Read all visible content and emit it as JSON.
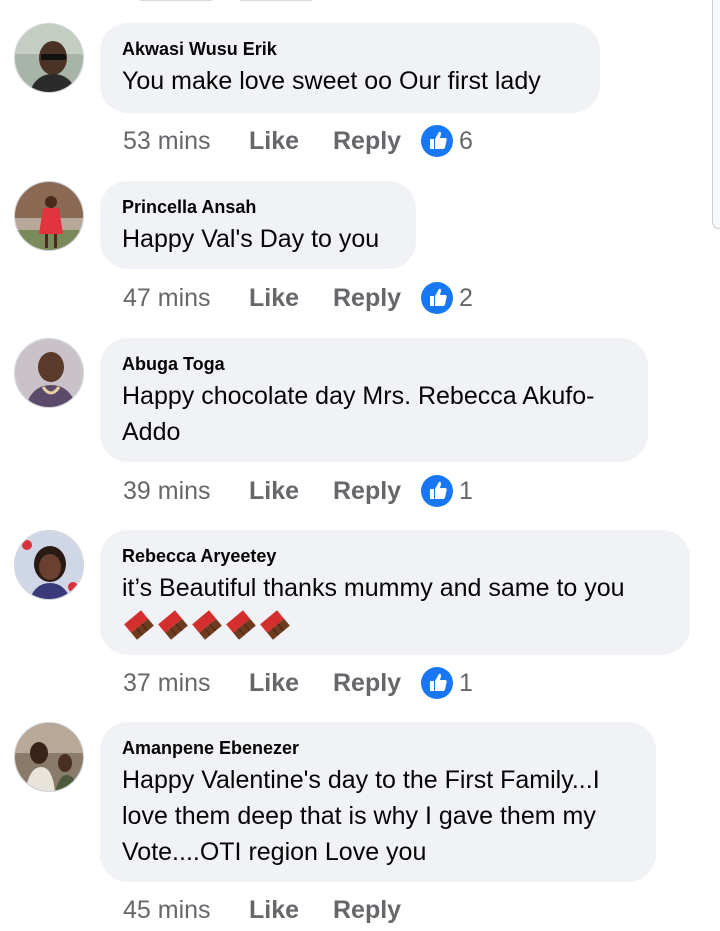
{
  "comments": [
    {
      "author": "Akwasi Wusu Erik",
      "text": "You make love  sweet oo Our first lady",
      "time": "53 mins",
      "like_label": "Like",
      "reply_label": "Reply",
      "reactions": "6",
      "avatar_icon": "user-photo-icon"
    },
    {
      "author": "Princella Ansah",
      "text": "Happy Val's Day to you",
      "time": "47 mins",
      "like_label": "Like",
      "reply_label": "Reply",
      "reactions": "2",
      "avatar_icon": "user-photo-icon"
    },
    {
      "author": "Abuga Toga",
      "text_line1": "Happy chocolate day Mrs. Rebecca Akufo-",
      "text_line2": "Addo",
      "time": "39 mins",
      "like_label": "Like",
      "reply_label": "Reply",
      "reactions": "1",
      "avatar_icon": "user-photo-icon"
    },
    {
      "author": "Rebecca Aryeetey",
      "text": "it’s Beautiful thanks mummy and same to you",
      "emoji": "chocolate-bar-icon",
      "emoji_count": 5,
      "time": "37 mins",
      "like_label": "Like",
      "reply_label": "Reply",
      "reactions": "1",
      "avatar_icon": "user-photo-icon"
    },
    {
      "author": "Amanpene Ebenezer",
      "text_line1": "Happy Valentine's day to the First Family...I",
      "text_line2": "love them deep that is why I gave them my",
      "text_line3": "Vote....OTI region Love you",
      "time": "45 mins",
      "like_label": "Like",
      "reply_label": "Reply",
      "avatar_icon": "user-photo-icon"
    }
  ],
  "colors": {
    "bubble_bg": "#f0f2f5",
    "meta_text": "#65676b",
    "like_blue": "#1877f2"
  }
}
